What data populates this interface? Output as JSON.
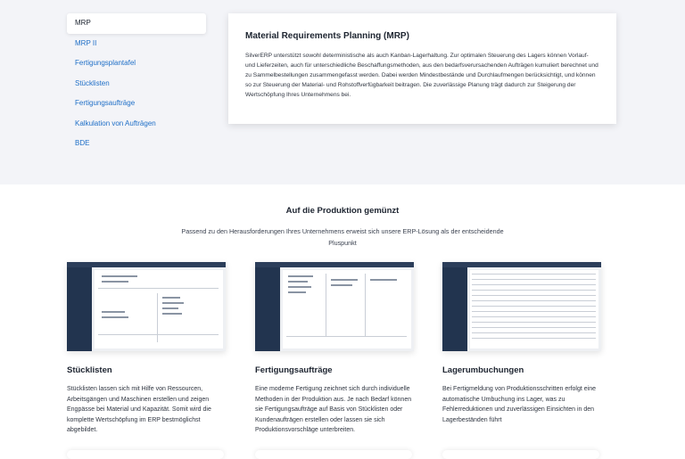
{
  "tabs": [
    {
      "label": "MRP",
      "active": true
    },
    {
      "label": "MRP II",
      "active": false
    },
    {
      "label": "Fertigungsplantafel",
      "active": false
    },
    {
      "label": "Stücklisten",
      "active": false
    },
    {
      "label": "Fertigungsaufträge",
      "active": false
    },
    {
      "label": "Kalkulation von Aufträgen",
      "active": false
    },
    {
      "label": "BDE",
      "active": false
    }
  ],
  "content": {
    "title": "Material Requirements Planning (MRP)",
    "body": "SilverERP unterstützt sowohl deterministische als auch Kanban-Lagerhaltung. Zur optimalen Steuerung des Lagers können Vorlauf- und Lieferzeiten, auch für unterschiedliche Beschaffungsmethoden, aus den bedarfsverursachenden Aufträgen kumuliert berechnet und zu Sammelbestellungen zusammengefasst werden. Dabei werden Mindestbestände und Durchlaufmengen berücksichtigt, und können so zur Steuerung der Material- und Rohstoffverfügbarkeit beitragen. Die zuverlässige Planung trägt dadurch zur Steigerung der Wertschöpfung Ihres Unternehmens bei."
  },
  "section": {
    "title": "Auf die Produktion gemünzt",
    "subtitle": "Passend zu den Herausforderungen Ihres Unternehmens erweist sich unsere ERP-Lösung als der entscheidende Pluspunkt"
  },
  "features": [
    {
      "title": "Stücklisten",
      "text": "Stücklisten lassen sich mit Hilfe von Ressourcen, Arbeitsgängen und Maschinen erstellen und zeigen Engpässe bei Material und Kapazität. Somit wird die komplette Wertschöpfung im ERP bestmöglichst abgebildet."
    },
    {
      "title": "Fertigungsaufträge",
      "text": "Eine moderne Fertigung zeichnet sich durch individuelle Methoden in der Produktion aus. Je nach Bedarf können sie Fertigungsaufträge auf Basis von Stücklisten oder Kundenaufträgen erstellen oder lassen sie sich Produktionsvorschläge unterbreiten."
    },
    {
      "title": "Lagerumbuchungen",
      "text": "Bei Fertigmeldung von Produktionsschritten erfolgt eine automatische Umbuchung ins Lager, was zu Fehlerreduktionen und zuverlässigen Einsichten in den Lagerbeständen führt"
    }
  ],
  "colors": {
    "accent": "#1f6fc7",
    "band": "#f3f4f8",
    "sidebar": "#22344f"
  }
}
